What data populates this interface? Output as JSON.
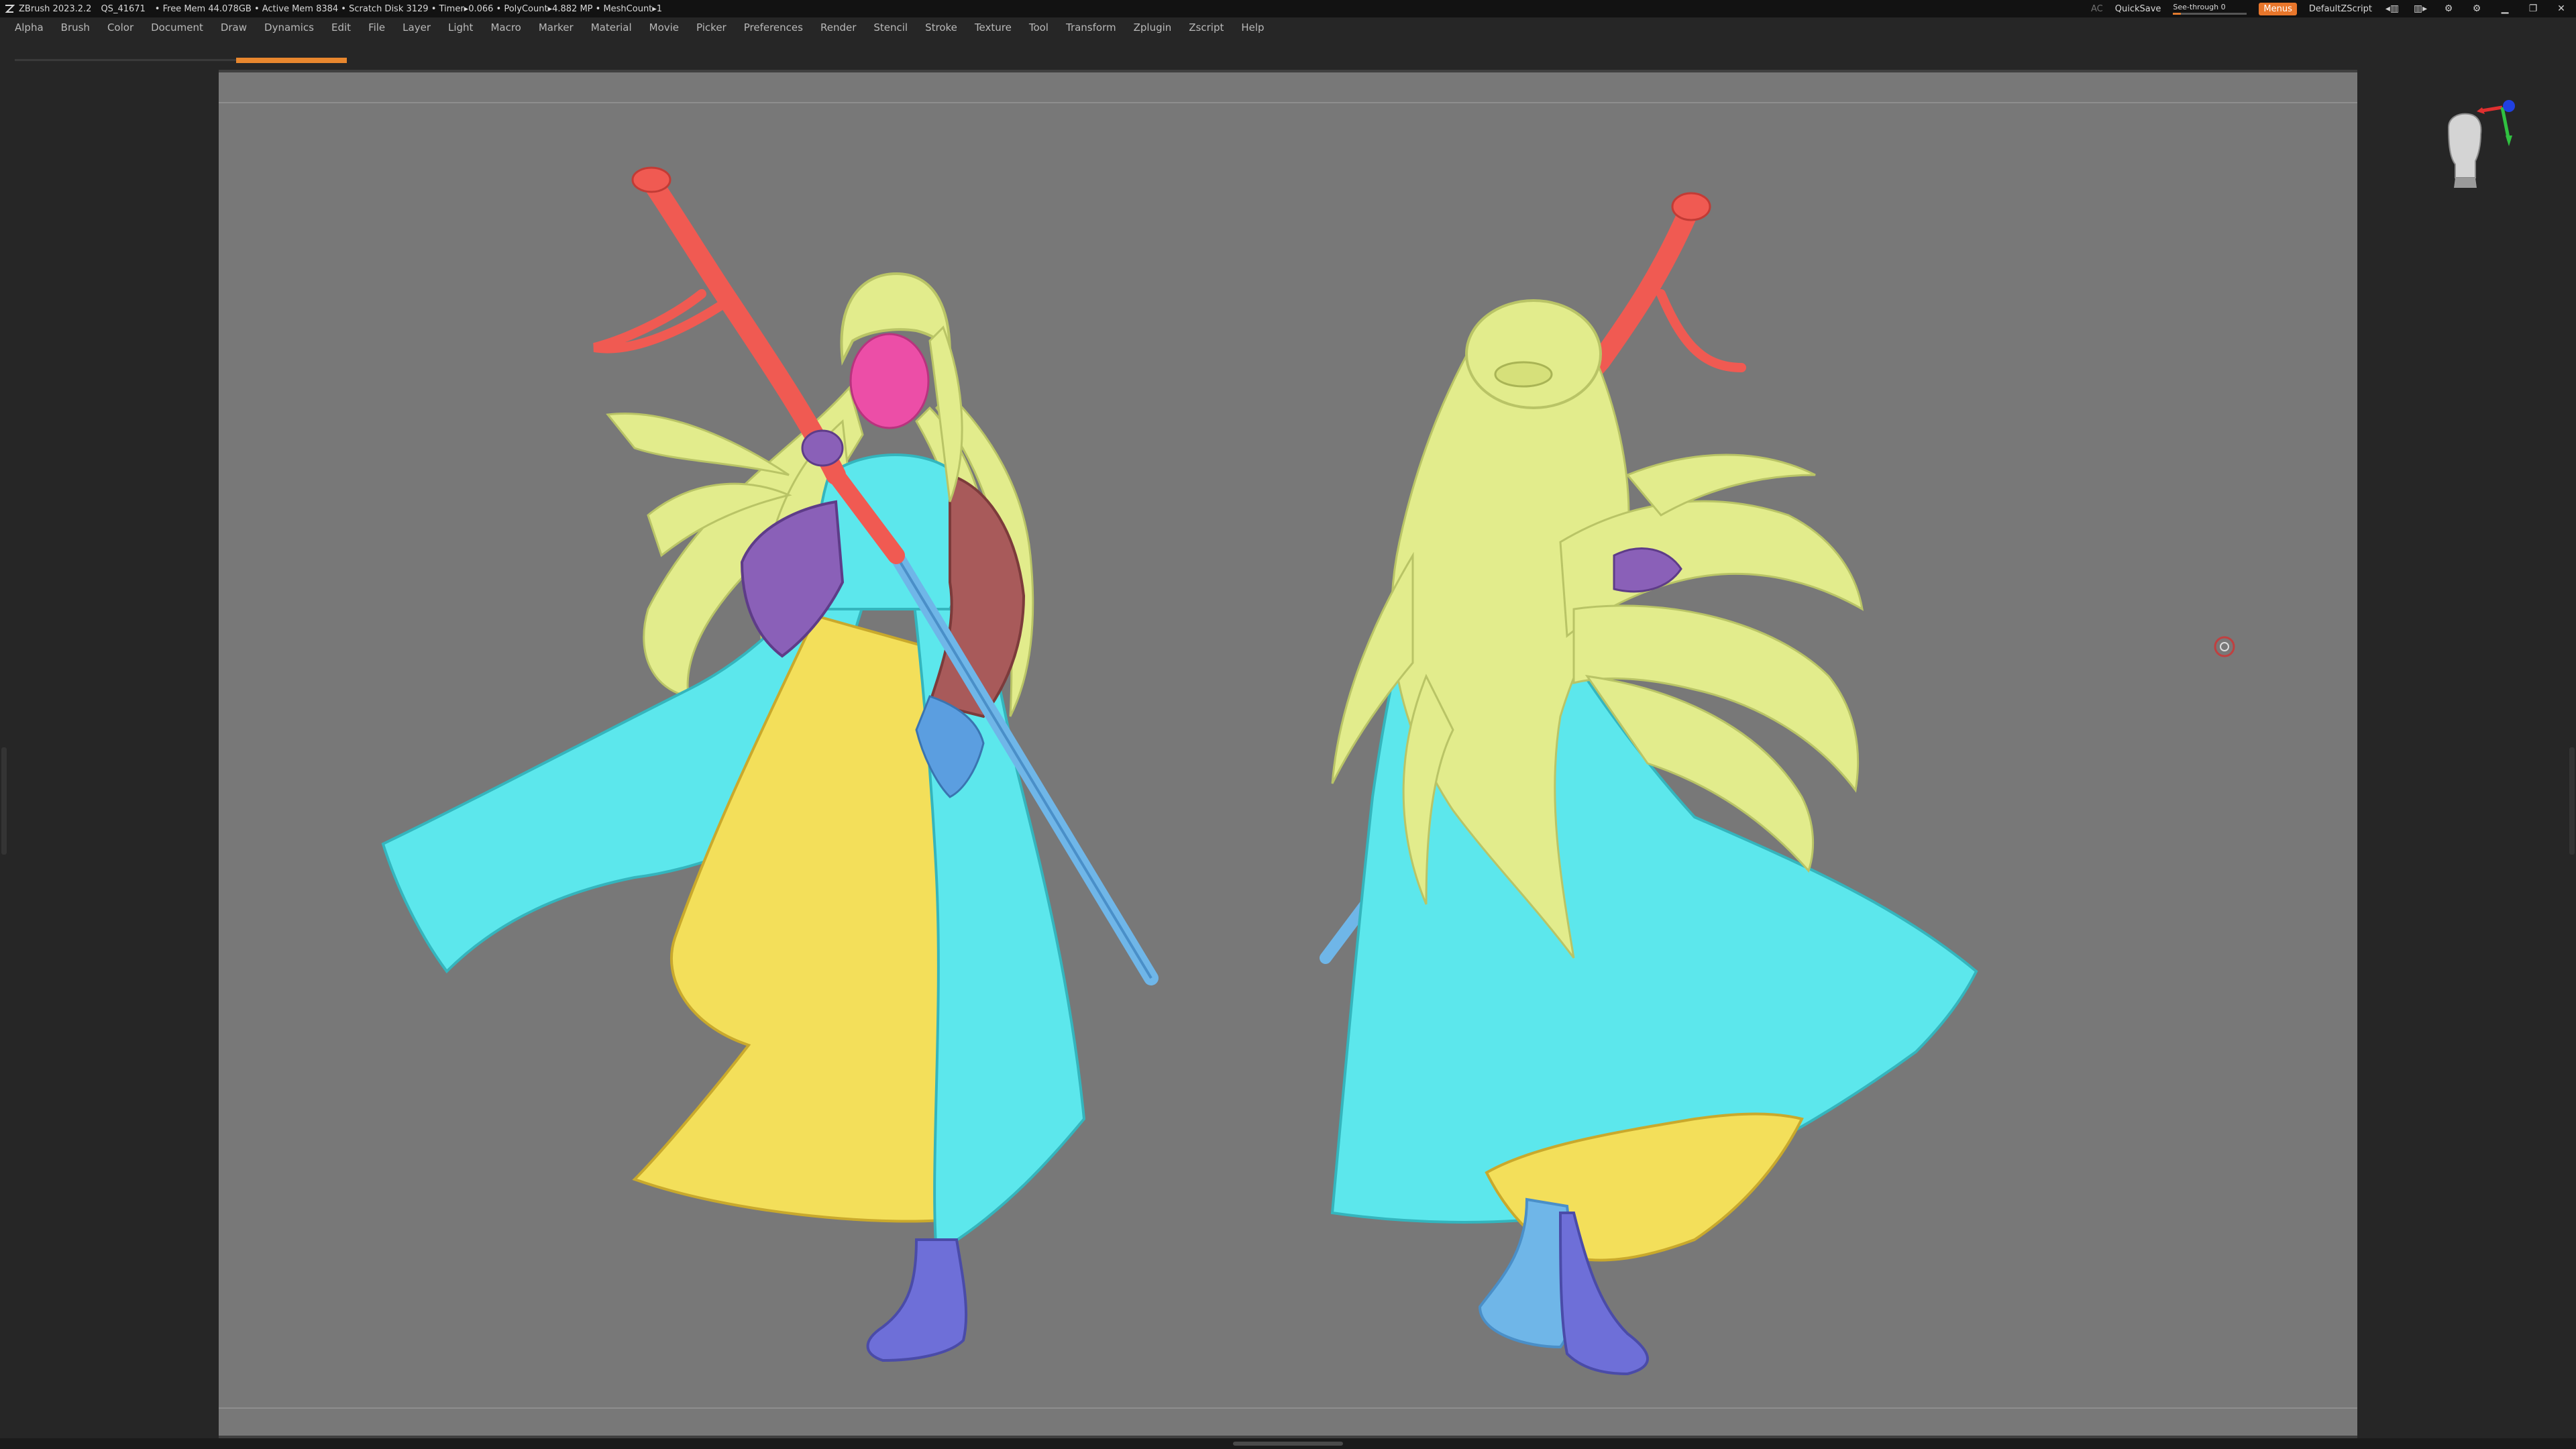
{
  "titlebar": {
    "app_title": "ZBrush 2023.2.2",
    "doc_id": "QS_41671",
    "stats": "• Free Mem 44.078GB • Active Mem 8384 • Scratch Disk 3129 • Timer▸0.066 • PolyCount▸4.882 MP • MeshCount▸1",
    "ac_label": "AC",
    "quicksave_label": "QuickSave",
    "see_through_label": "See-through 0",
    "see_through_value": 0,
    "menus_label": "Menus",
    "script_label": "DefaultZScript"
  },
  "menubar": {
    "items": [
      "Alpha",
      "Brush",
      "Color",
      "Document",
      "Draw",
      "Dynamics",
      "Edit",
      "File",
      "Layer",
      "Light",
      "Macro",
      "Marker",
      "Material",
      "Movie",
      "Picker",
      "Preferences",
      "Render",
      "Stencil",
      "Stroke",
      "Texture",
      "Tool",
      "Transform",
      "Zplugin",
      "Zscript",
      "Help"
    ]
  },
  "colors": {
    "accent": "#e8762b",
    "canvas_bg": "#787878",
    "hair": "#e2ec8c",
    "robe_cyan": "#5ce7ec",
    "skirt_yellow": "#f3df5a",
    "staff_red": "#f05a52",
    "face_magenta": "#ec4ea7",
    "sleeve_purple": "#8a60b8",
    "sleeve_brown": "#a85a5a",
    "boots_blue": "#6e6fd8",
    "staff_blue": "#6fb6e8"
  },
  "viewport": {
    "model_description_icon": "character-sculpt-front-and-back",
    "gizmo_icon": "navigation-gizmo-head-icon",
    "rotate_cursor_icon": "rotate-cursor-icon"
  }
}
